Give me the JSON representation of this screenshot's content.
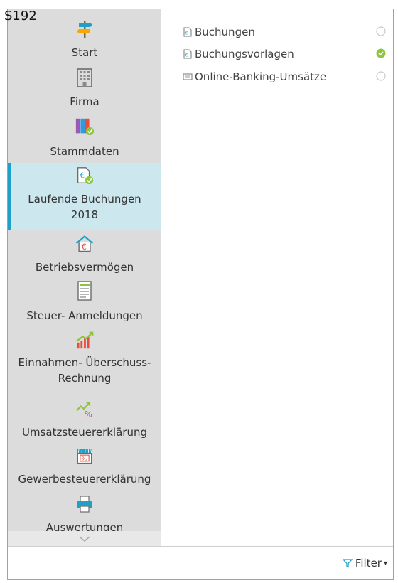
{
  "page_label": "S192",
  "sidebar": {
    "items": [
      {
        "label": "Start",
        "icon": "signpost-icon"
      },
      {
        "label": "Firma",
        "icon": "building-icon"
      },
      {
        "label": "Stammdaten",
        "icon": "folders-icon"
      },
      {
        "label": "Laufende Buchungen 2018",
        "icon": "euro-document-check-icon",
        "active": true
      },
      {
        "label": "Betriebsvermögen",
        "icon": "house-euro-icon"
      },
      {
        "label": "Steuer- Anmeldungen",
        "icon": "form-list-icon"
      },
      {
        "label": "Einnahmen- Überschuss- Rechnung",
        "icon": "bar-chart-icon"
      },
      {
        "label": "Umsatzsteuererklärung",
        "icon": "percent-trend-icon"
      },
      {
        "label": "Gewerbesteuererklärung",
        "icon": "shop-percent-icon"
      },
      {
        "label": "Auswertungen",
        "icon": "printer-icon"
      }
    ]
  },
  "content": {
    "items": [
      {
        "label": "Buchungen",
        "icon": "document-icon",
        "status": "empty"
      },
      {
        "label": "Buchungsvorlagen",
        "icon": "document-icon",
        "status": "done"
      },
      {
        "label": "Online-Banking-Umsätze",
        "icon": "screen-icon",
        "status": "empty"
      }
    ]
  },
  "footer": {
    "filter_label": "Filter",
    "filter_icon": "funnel-icon"
  },
  "colors": {
    "accent": "#1ea0c8",
    "sidebar_bg": "#dcdcdc",
    "active_bg": "#cde7ef",
    "check_green": "#8cc63f"
  }
}
